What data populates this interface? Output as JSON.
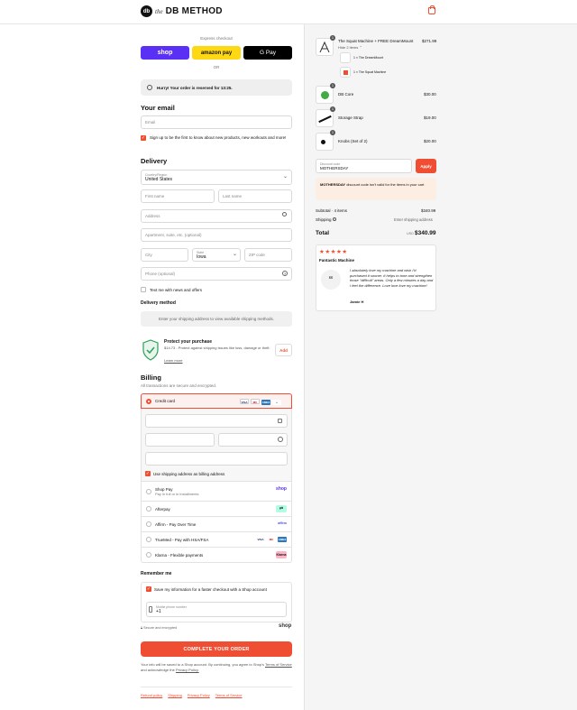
{
  "brand": {
    "prefix": "the",
    "name": "DB METHOD",
    "mark": "db"
  },
  "express": {
    "title": "Express checkout",
    "or": "OR",
    "buttons": [
      {
        "label": "shop",
        "color": "#5a31f4"
      },
      {
        "label": "amazon pay",
        "color": "#ffd814"
      },
      {
        "label": "G Pay",
        "color": "#000000"
      }
    ]
  },
  "reserve_notice": "Hurry! Your order is reserved for 13:25.",
  "email": {
    "heading": "Your email",
    "placeholder": "Email",
    "signup": "Sign up to be the first to know about new products, new workouts and more!"
  },
  "delivery": {
    "heading": "Delivery",
    "country_label": "Country/Region",
    "country_value": "United States",
    "first_name": "First name",
    "last_name": "Last name",
    "address": "Address",
    "apartment": "Apartment, suite, etc. (optional)",
    "city": "City",
    "state_label": "State",
    "state_value": "Iowa",
    "zip": "ZIP code",
    "phone": "Phone (optional)",
    "text_me": "Text me with news and offers",
    "method_heading": "Delivery method",
    "method_note": "Enter your shipping address to view available shipping methods."
  },
  "protect": {
    "title": "Protect your purchase",
    "desc": "$14.73 - Protect against shipping issues like loss, damage or theft.",
    "learn": "Learn more",
    "add": "Add"
  },
  "billing": {
    "heading": "Billing",
    "subtitle": "All transactions are secure and encrypted.",
    "credit_card": "Credit card",
    "card_logos": [
      "VISA",
      "MC",
      "AMEX",
      "+"
    ],
    "same_address": "Use shipping address as billing address",
    "options": [
      {
        "name": "Shop Pay",
        "sub": "Pay in full or in installments",
        "logo": "shop"
      },
      {
        "name": "Afterpay",
        "sub": "",
        "logo": "afterpay"
      },
      {
        "name": "Affirm - Pay Over Time",
        "sub": "",
        "logo": "affirm"
      },
      {
        "name": "TrueMed - Pay with HSA/FSA",
        "sub": "",
        "logo": "cards"
      },
      {
        "name": "Klarna - Flexible payments",
        "sub": "",
        "logo": "Klarna"
      }
    ]
  },
  "remember": {
    "heading": "Remember me",
    "save_info": "Save my information for a faster checkout with a Shop account",
    "phone_label": "Mobile phone number",
    "phone_value": "+1",
    "secure": "Secure and encrypted",
    "shop_logo": "shop"
  },
  "complete_button": "COMPLETE YOUR ORDER",
  "legal": {
    "text1": "Your info will be saved to a Shop account. By continuing, you agree to Shop's",
    "terms": "Terms of Service",
    "text2": "and acknowledge the",
    "privacy": "Privacy Policy."
  },
  "footer_links": [
    "Refund policy",
    "Shipping",
    "Privacy Policy",
    "Terms of Service"
  ],
  "order": {
    "items": [
      {
        "name": "The Squat Machine + FREE DreamMount",
        "hide": "Hide 2 items",
        "price": "$271.99",
        "qty": "1",
        "subitems": [
          "1 × The DreamMount",
          "1 × The Squat Machine"
        ]
      },
      {
        "name": "DB Core",
        "price": "$30.00",
        "qty": "1"
      },
      {
        "name": "Storage Strap",
        "price": "$19.00",
        "qty": "1"
      },
      {
        "name": "Knobs (Set of 2)",
        "price": "$20.00",
        "qty": "1"
      }
    ],
    "discount_label": "Discount code",
    "discount_value": "MOTHERSDAY",
    "apply": "Apply",
    "discount_error_code": "MOTHERSDAY",
    "discount_error": "discount code isn't valid for the items in your cart",
    "subtotal_label": "Subtotal · 4 items",
    "subtotal_value": "$340.99",
    "shipping_label": "Shipping",
    "shipping_value": "Enter shipping address",
    "total_label": "Total",
    "currency": "USD",
    "total_value": "$340.99"
  },
  "review": {
    "stars": "★★★★★",
    "title": "Fantastic Machine",
    "text": "I absolutely love my machine and wish I'd purchased it sooner. It helps to tone and strengthen those \"difficult\" areas. Only a few minutes a day and I feel the difference. Love love love my machine!",
    "author": "Jamie H"
  },
  "colors": {
    "accent": "#f04e33",
    "shop": "#5a31f4",
    "amazon": "#ffd814"
  }
}
